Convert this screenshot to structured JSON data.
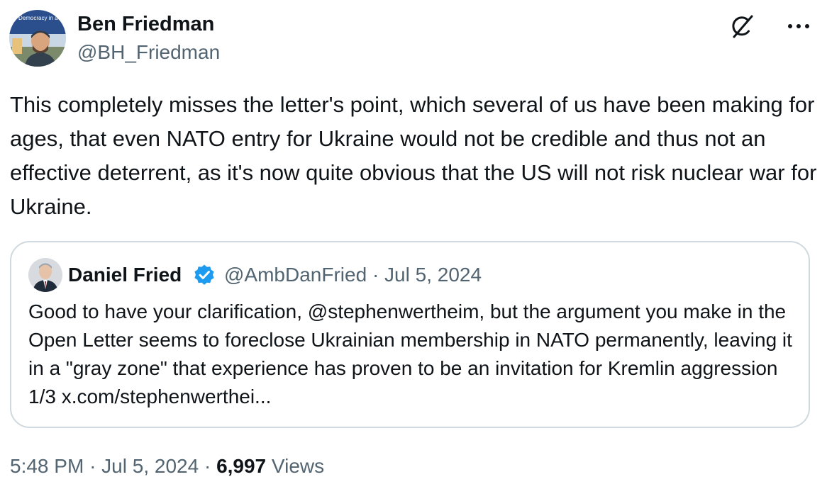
{
  "author": {
    "name": "Ben Friedman",
    "handle": "@BH_Friedman",
    "avatar_banner_text": "Democracy in action"
  },
  "tweet": {
    "text": "This completely misses the letter's point, which several of us have been making for ages, that even NATO entry for Ukraine would not be credible and thus not an effective deterrent, as it's now quite obvious that the US will not risk nuclear war for Ukraine."
  },
  "quote": {
    "name": "Daniel Fried",
    "handle": "@AmbDanFried",
    "separator": "·",
    "date": "Jul 5, 2024",
    "text": "Good to have your clarification, @stephenwertheim, but the argument you make in the Open Letter seems to foreclose Ukrainian membership in NATO permanently, leaving it in a \"gray zone\" that experience has proven to be an invitation for Kremlin aggression 1/3 x.com/stephenwerthei..."
  },
  "footer": {
    "time": "5:48 PM",
    "separator": "·",
    "date": "Jul 5, 2024",
    "views_count": "6,997",
    "views_label": "Views"
  },
  "icons": {
    "grok": "grok-icon",
    "more": "more-horizontal-icon",
    "verified": "verified-badge-icon"
  },
  "colors": {
    "text_primary": "#0f1419",
    "text_secondary": "#536471",
    "border": "#cfd9de",
    "verified_blue": "#1d9bf0"
  }
}
